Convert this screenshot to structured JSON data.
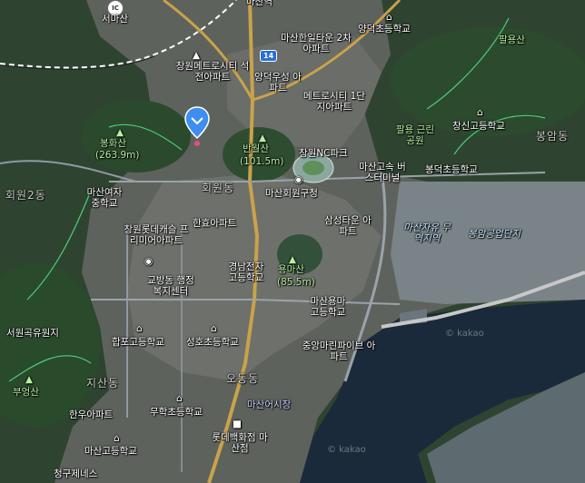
{
  "map": {
    "watermark": "© kakao",
    "highway_shield": "14",
    "ic_badge": "IC"
  },
  "labels": {
    "top_station": "마산역",
    "seomasan": "서마산",
    "masan_hanil_2": "마산한일타운 2차아파트",
    "yangdeok_school": "양덕초등학교",
    "palyongsan": "팔용산",
    "changwon_metrocity_seokjeon": "창원메트로시티 석전아파트",
    "yangdeok_wooseong": "양덕우성 아파트",
    "metrocity_1": "메트로시티 1단지아파트",
    "palyong_park": "팔용 근린공원",
    "changsin_high": "창신고등학교",
    "bonghwasan": "봉화산",
    "bonghwasan_height": "(263.9m)",
    "banwolsan": "반월산",
    "banwolsan_height": "(101.5m)",
    "changwon_nc_park": "창원NC파크",
    "bongam_dong": "봉암동",
    "masan_bus_terminal": "마산고속 버스터미널",
    "bongdeok_school": "봉덕초등학교",
    "hoewon_2_dong": "회원2동",
    "masan_girls_middle": "마산여자 중학교",
    "masan_hoewon_office": "마산회원구청",
    "hoewon_dong_faint": "회원동",
    "samsung_town": "삼성타운 아파트",
    "masan_free_trade": "마산자유 무역지역",
    "bongam_industrial": "봉암공업단지",
    "hanhyo_apt": "한효아파트",
    "changwon_lotte_castle": "창원롯데캐슬 프리미어아파트",
    "gyeongnam_elec_high": "경남전자 고등학교",
    "yongmasan": "용마산",
    "yongmasan_height": "(85.5m)",
    "gyobang_dong_center": "교방동 행정복지센터",
    "masan_yongma_high": "마산용마 고등학교",
    "seowon_reservoir": "서원곡유원지",
    "happo_school": "합포고등학교",
    "seongho_school": "성호초등학교",
    "jungang_marina": "중앙마린파이브 아파트",
    "bueongsan": "부엉산",
    "jisan_dong": "지산동",
    "odong_dong": "오동동",
    "hanu_apt": "한우아파트",
    "muhak_school": "무학초등학교",
    "masan_fish_market": "마산어시장",
    "masan_high": "마산고등학교",
    "lotte_dept": "롯데백화점 마산점",
    "cheonggu_genes": "청구제네스"
  },
  "colors": {
    "water": "#1b2a3a",
    "road_major": "#c9a24a",
    "road_minor": "#8f9aa3",
    "marker": "#3d8ef0",
    "forest": "#2f4632",
    "urban": "#6b6f6a"
  }
}
